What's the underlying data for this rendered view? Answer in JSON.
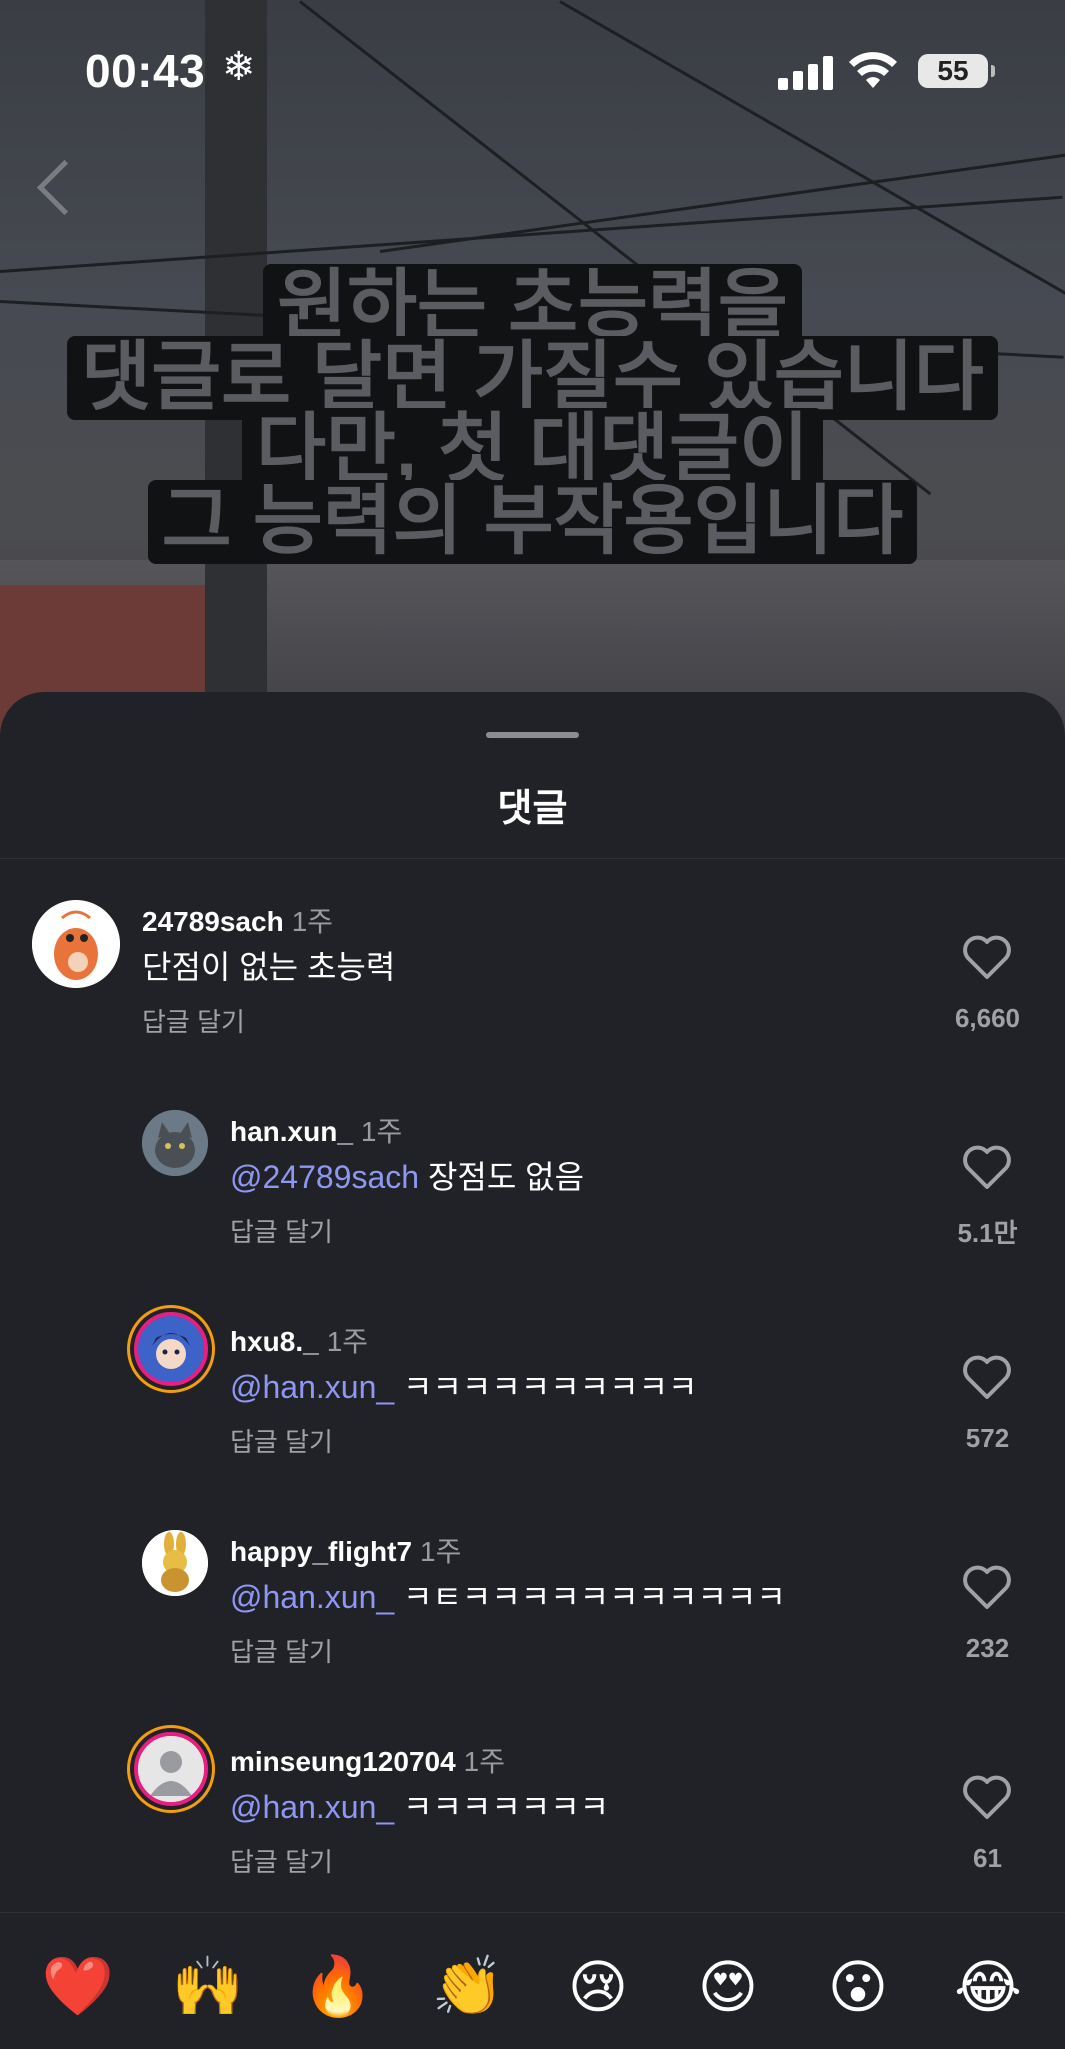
{
  "status_bar": {
    "time": "00:43",
    "battery": "55"
  },
  "story": {
    "caption_lines": [
      "원하는 초능력을",
      "댓글로 달면 가질수 있습니다",
      "다만, 첫 대댓글이",
      "그 능력의 부작용입니다"
    ]
  },
  "sheet": {
    "title": "댓글"
  },
  "comments": [
    {
      "username": "24789sach",
      "time": "1주",
      "mention": "",
      "text": "단점이 없는 초능력",
      "reply": "답글 달기",
      "likes": "6,660"
    },
    {
      "username": "han.xun_",
      "time": "1주",
      "mention": "@24789sach",
      "text": " 장점도 없음",
      "reply": "답글 달기",
      "likes": "5.1만"
    },
    {
      "username": "hxu8._",
      "time": "1주",
      "mention": "@han.xun_",
      "text": " ㅋㅋㅋㅋㅋㅋㅋㅋㅋㅋ",
      "reply": "답글 달기",
      "likes": "572"
    },
    {
      "username": "happy_flight7",
      "time": "1주",
      "mention": "@han.xun_",
      "text": " ㅋㅌㅋㅋㅋㅋㅋㅋㅋㅋㅋㅋㅋ",
      "reply": "답글 달기",
      "likes": "232"
    },
    {
      "username": "minseung120704",
      "time": "1주",
      "mention": "@han.xun_",
      "text": " ㅋㅋㅋㅋㅋㅋㅋ",
      "reply": "답글 달기",
      "likes": "61"
    }
  ],
  "emoji_bar": [
    "❤️",
    "🙌",
    "🔥",
    "👏",
    "😢",
    "😍",
    "😮",
    "😂"
  ]
}
